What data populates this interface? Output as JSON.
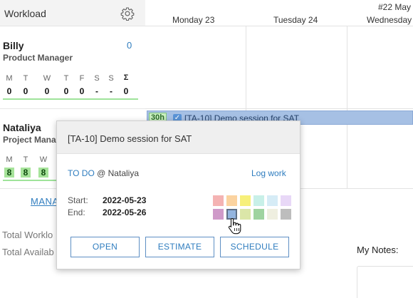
{
  "left": {
    "title": "Workload",
    "gear_icon": "gear-icon",
    "users": [
      {
        "name": "Billy",
        "role": "Product Manager",
        "count": "0",
        "day_labels": [
          "M",
          "T",
          "W",
          "T",
          "F",
          "S",
          "S",
          "Σ"
        ],
        "day_values": [
          "0",
          "0",
          "0",
          "0",
          "0",
          "-",
          "-",
          "0"
        ]
      },
      {
        "name": "Nataliya",
        "role": "Project Manag",
        "day_labels": [
          "M",
          "T",
          "W"
        ],
        "day_values": [
          "8",
          "8",
          "8"
        ]
      }
    ],
    "manage_label": "MANA",
    "total_workload_label": "Total Worklo",
    "total_available_label": "Total Availab"
  },
  "calendar": {
    "week_label": "#22 May",
    "days": [
      "Monday 23",
      "Tuesday 24",
      "Wednesday"
    ],
    "task_bar": {
      "hours": "30h",
      "title": "[TA-10] Demo session for SAT"
    }
  },
  "notes": {
    "label": "My Notes:"
  },
  "popup": {
    "title": "[TA-10] Demo session for SAT",
    "status": "TO DO",
    "assignee_prefix": "@ Nataliya",
    "log_work": "Log work",
    "start_label": "Start:",
    "start_value": "2022-05-23",
    "end_label": "End:",
    "end_value": "2022-05-26",
    "colors": [
      "#f4b3b3",
      "#fbd3a0",
      "#f7f07a",
      "#c8f0e8",
      "#d6ecf6",
      "#e8d8f7",
      "#cf9ac9",
      "#93b4df",
      "#dbe6a8",
      "#9fd3a0",
      "#efefe0",
      "#bdbdbd"
    ],
    "selected_color_index": 7,
    "buttons": [
      "OPEN",
      "ESTIMATE",
      "SCHEDULE"
    ]
  }
}
